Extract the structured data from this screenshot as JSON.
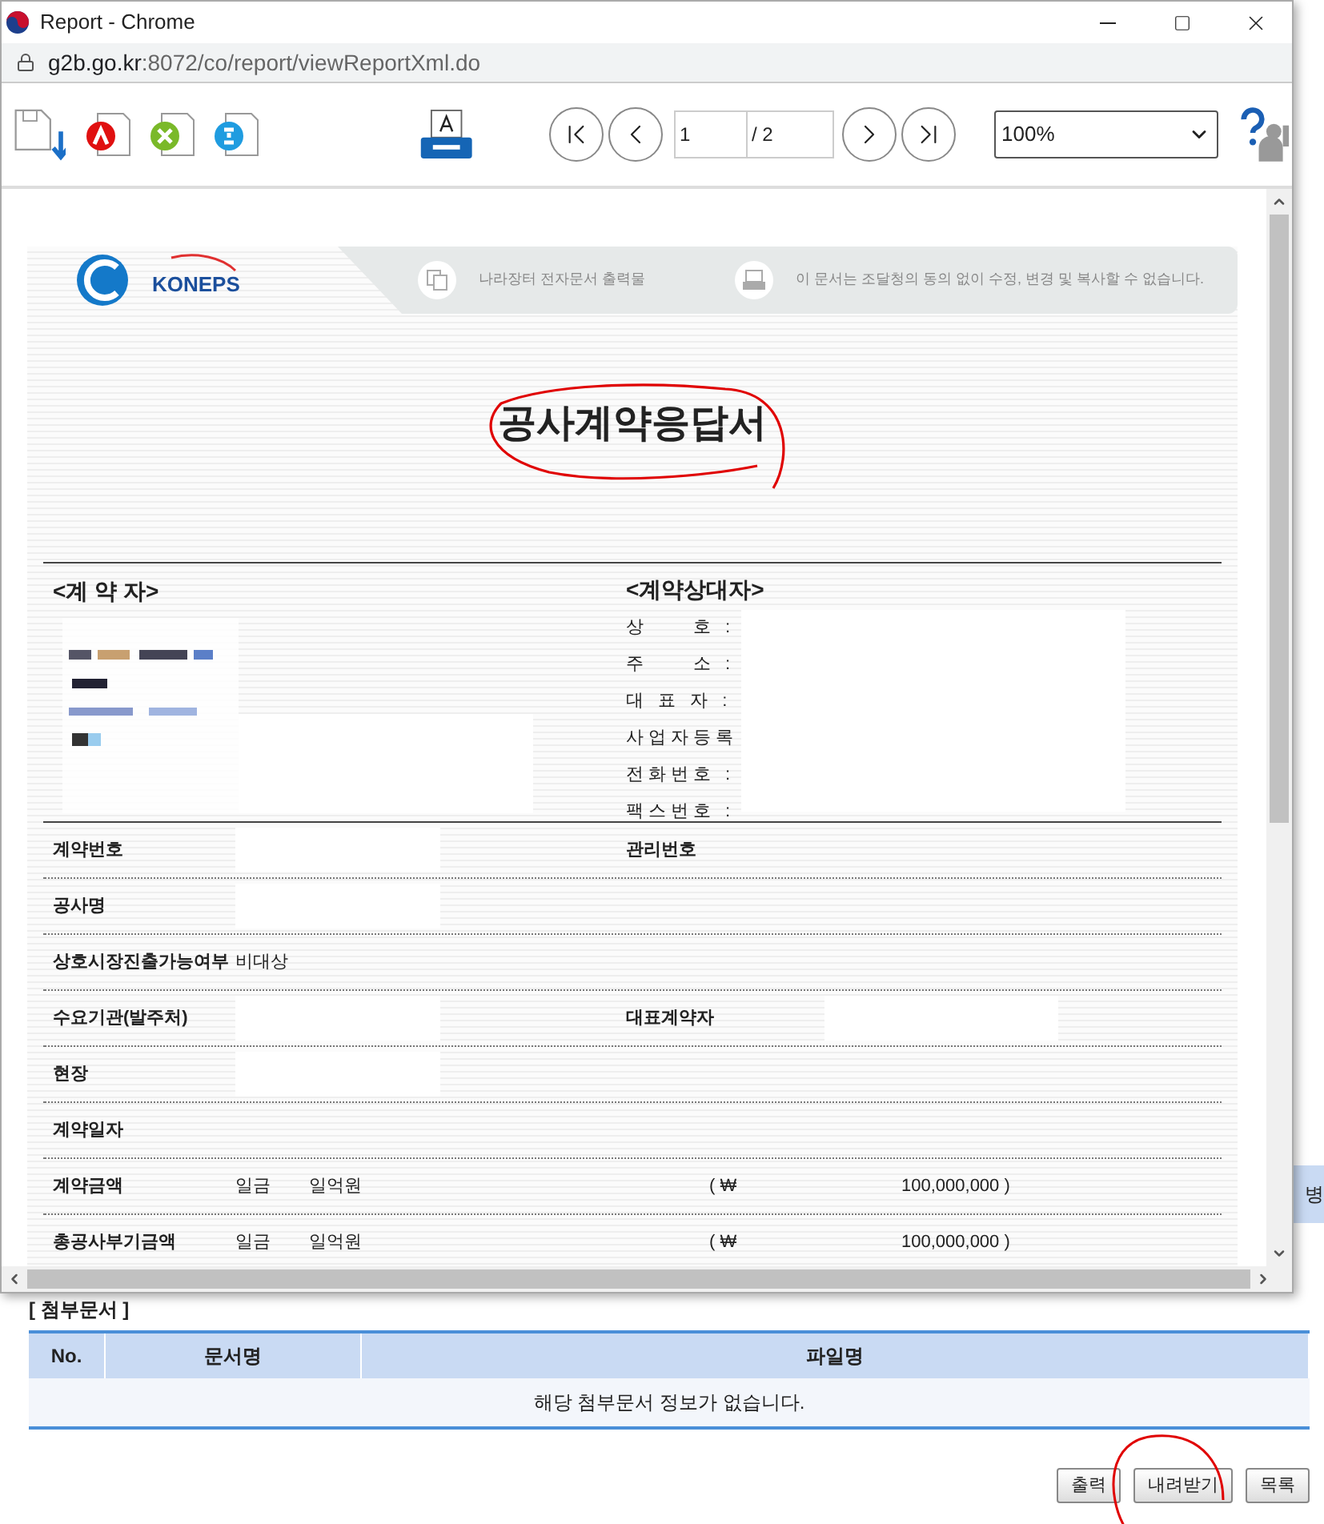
{
  "window": {
    "title": "Report - Chrome"
  },
  "address": {
    "host": "g2b.go.kr",
    "path": ":8072/co/report/viewReportXml.do"
  },
  "toolbar": {
    "page": "1",
    "total": "/ 2",
    "zoom": "100%"
  },
  "document": {
    "banner": [
      "나라장터 전자문서 출력물",
      "이 문서는 조달청의 동의 없이 수정, 변경 및 복사할 수 없습니다."
    ],
    "logo": "KONEPS",
    "title": "공사계약응답서",
    "contractor_heading": "<계 약 자>",
    "counterparty_heading": "<계약상대자>",
    "counterparty_fields": [
      "상　　호 :",
      "주　　소 :",
      "대 표 자 :",
      "사업자등록",
      "전화번호 :",
      "팩스번호 :"
    ],
    "rows": [
      {
        "kind": "pair",
        "label": "계약번호",
        "redacted": true,
        "label2": "관리번호"
      },
      {
        "kind": "pair",
        "label": "공사명",
        "redacted": true
      },
      {
        "kind": "pair",
        "label": "상호시장진출가능여부",
        "value": "비대상"
      },
      {
        "kind": "pair",
        "label": "수요기관(발주처)",
        "redacted": true,
        "label2": "대표계약자",
        "redacted2": true
      },
      {
        "kind": "pair",
        "label": "현장",
        "redacted": true
      },
      {
        "kind": "pair",
        "label": "계약일자"
      },
      {
        "kind": "amount",
        "label": "계약금액",
        "prefix": "일금",
        "words": "일억원",
        "currency": "( ₩",
        "amount": "100,000,000 )"
      },
      {
        "kind": "amount",
        "label": "총공사부기금액",
        "prefix": "일금",
        "words": "일억원",
        "currency": "( ₩",
        "amount": "100,000,000 )"
      }
    ]
  },
  "background_page": {
    "edge_text": "병",
    "attachments": {
      "heading": "[ 첨부문서 ]",
      "columns": [
        "No.",
        "문서명",
        "파일명"
      ],
      "empty_message": "해당 첨부문서 정보가 없습니다."
    },
    "buttons": [
      "출력",
      "내려받기",
      "목록"
    ]
  }
}
